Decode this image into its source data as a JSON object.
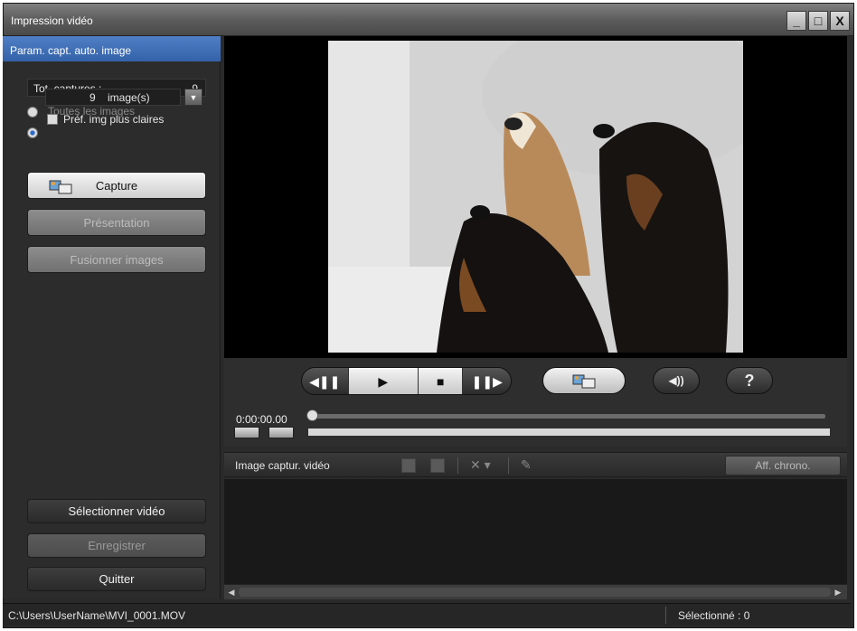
{
  "window": {
    "title": "Impression vidéo",
    "buttons": [
      "_",
      "□",
      "X"
    ]
  },
  "left_panel": {
    "header": "Param. capt. auto. image",
    "total_captures_label": "Tot. captures :",
    "total_captures_value": "9",
    "option_all_images": "Toutes les images",
    "image_count": "9",
    "image_unit": "image(s)",
    "prefer_bright_label": "Préf. img plus claires",
    "capture_button": "Capture",
    "slideshow_button": "Présentation",
    "merge_button": "Fusionner images",
    "select_video_button": "Sélectionner vidéo",
    "save_button": "Enregistrer",
    "quit_button": "Quitter"
  },
  "player": {
    "time": "0:00:00.00",
    "help_label": "?"
  },
  "captured_panel": {
    "label": "Image captur. vidéo",
    "chrono_button": "Aff. chrono."
  },
  "status": {
    "file_path": "C:\\Users\\UserName\\MVI_0001.MOV",
    "selected": "Sélectionné : 0"
  },
  "icons": [
    "capture-icon",
    "rewind-frame-icon",
    "play-icon",
    "stop-icon",
    "forward-frame-icon",
    "volume-icon",
    "help-icon",
    "delete-icon",
    "pen-icon"
  ]
}
